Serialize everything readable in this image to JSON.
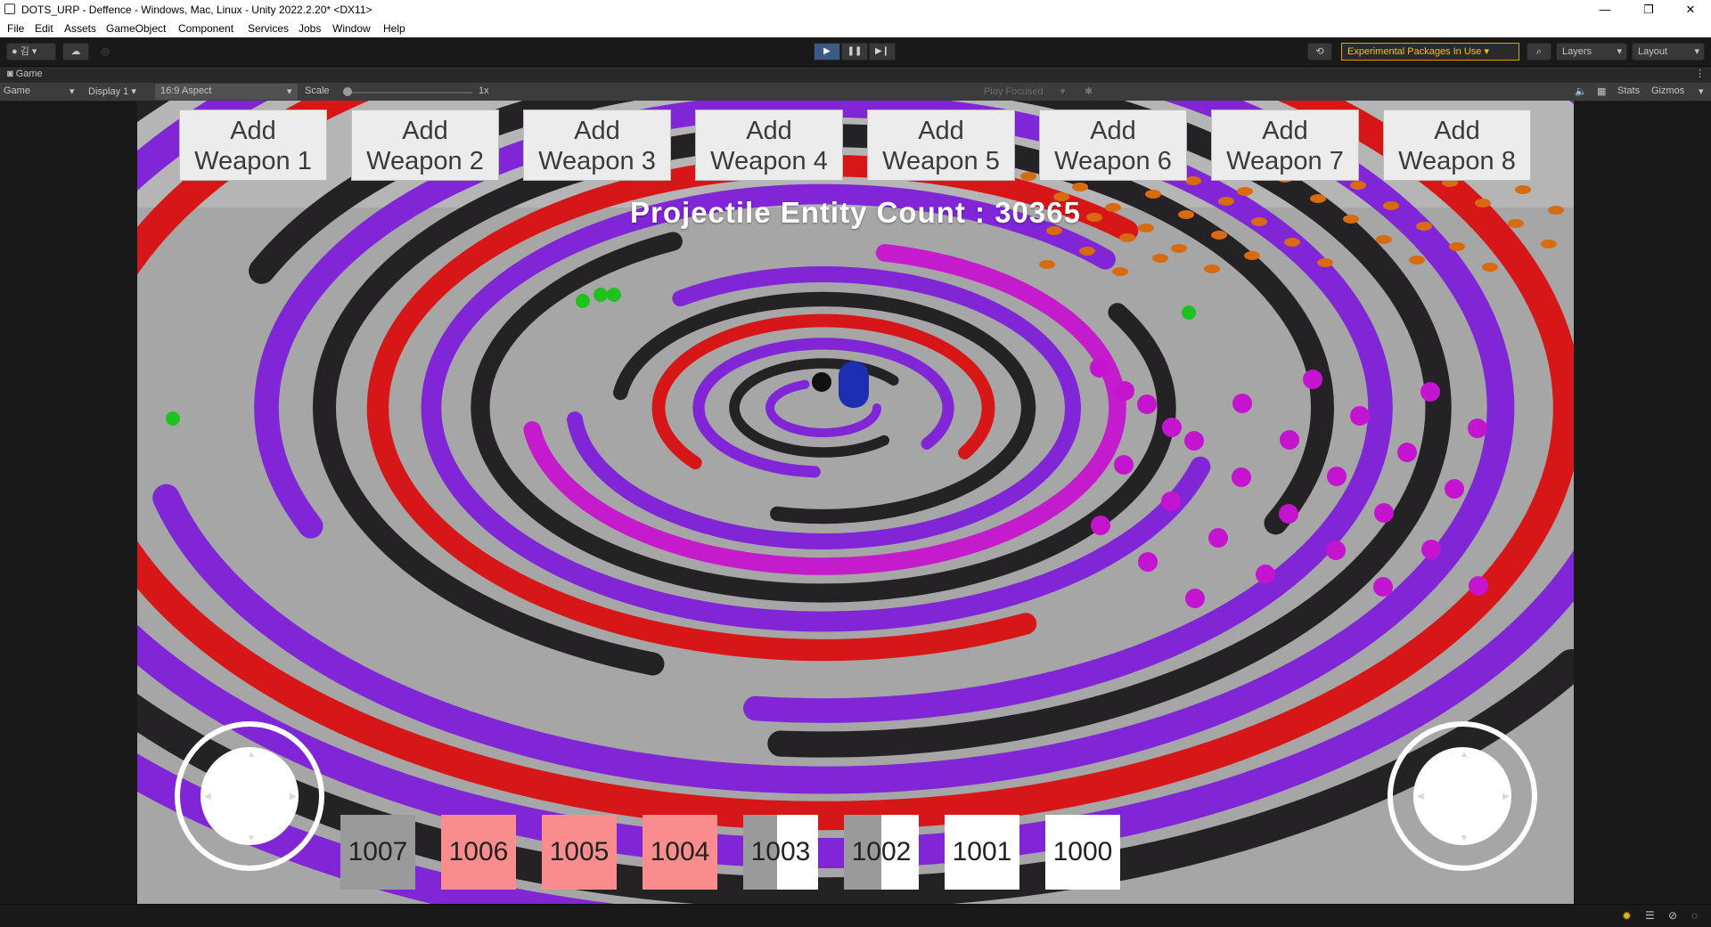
{
  "window": {
    "title": "DOTS_URP - Deffence - Windows, Mac, Linux - Unity 2022.2.20* <DX11>",
    "minimize": "—",
    "restore": "❐",
    "close": "✕"
  },
  "menu": [
    "File",
    "Edit",
    "Assets",
    "GameObject",
    "Component",
    "Services",
    "Jobs",
    "Window",
    "Help"
  ],
  "toolbar": {
    "account_label": "김",
    "experimental": "Experimental Packages In Use ▾",
    "layers": "Layers",
    "layout": "Layout"
  },
  "game_tab": {
    "label": "Game",
    "game_dropdown": "Game",
    "display": "Display 1",
    "aspect": "16:9 Aspect",
    "scale_label": "Scale",
    "scale_value": "1x",
    "play_focused": "Play Focused",
    "stats": "Stats",
    "gizmos": "Gizmos",
    "scale_level": 0
  },
  "game": {
    "weapon_buttons": [
      "Add\nWeapon 1",
      "Add\nWeapon 2",
      "Add\nWeapon 3",
      "Add\nWeapon 4",
      "Add\nWeapon 5",
      "Add\nWeapon 6",
      "Add\nWeapon 7",
      "Add\nWeapon 8"
    ],
    "counter": "Projectile Entity Count : 30365",
    "slots": [
      {
        "label": "1007",
        "color": "#9a9a9a",
        "fill": 1.0,
        "bg": "#9a9a9a"
      },
      {
        "label": "1006",
        "color": "#f98d8d",
        "fill": 1.0,
        "bg": "#f98d8d"
      },
      {
        "label": "1005",
        "color": "#f98d8d",
        "fill": 1.0,
        "bg": "#f98d8d"
      },
      {
        "label": "1004",
        "color": "#f98d8d",
        "fill": 1.0,
        "bg": "#f98d8d"
      },
      {
        "label": "1003",
        "color": "#9a9a9a",
        "fill": 0.45,
        "bg": "#ffffff"
      },
      {
        "label": "1002",
        "color": "#9a9a9a",
        "fill": 0.5,
        "bg": "#ffffff"
      },
      {
        "label": "1001",
        "color": "#ffffff",
        "fill": 1.0,
        "bg": "#ffffff"
      },
      {
        "label": "1000",
        "color": "#ffffff",
        "fill": 1.0,
        "bg": "#ffffff"
      }
    ],
    "colors": {
      "purple": "#7d1fd8",
      "black": "#1e1a1e",
      "red": "#d90f0f",
      "magenta": "#c514cf",
      "orange": "#d86a10",
      "green": "#1ec21e",
      "blue": "#1c2fb2",
      "ground": "#a6a6a6"
    }
  }
}
